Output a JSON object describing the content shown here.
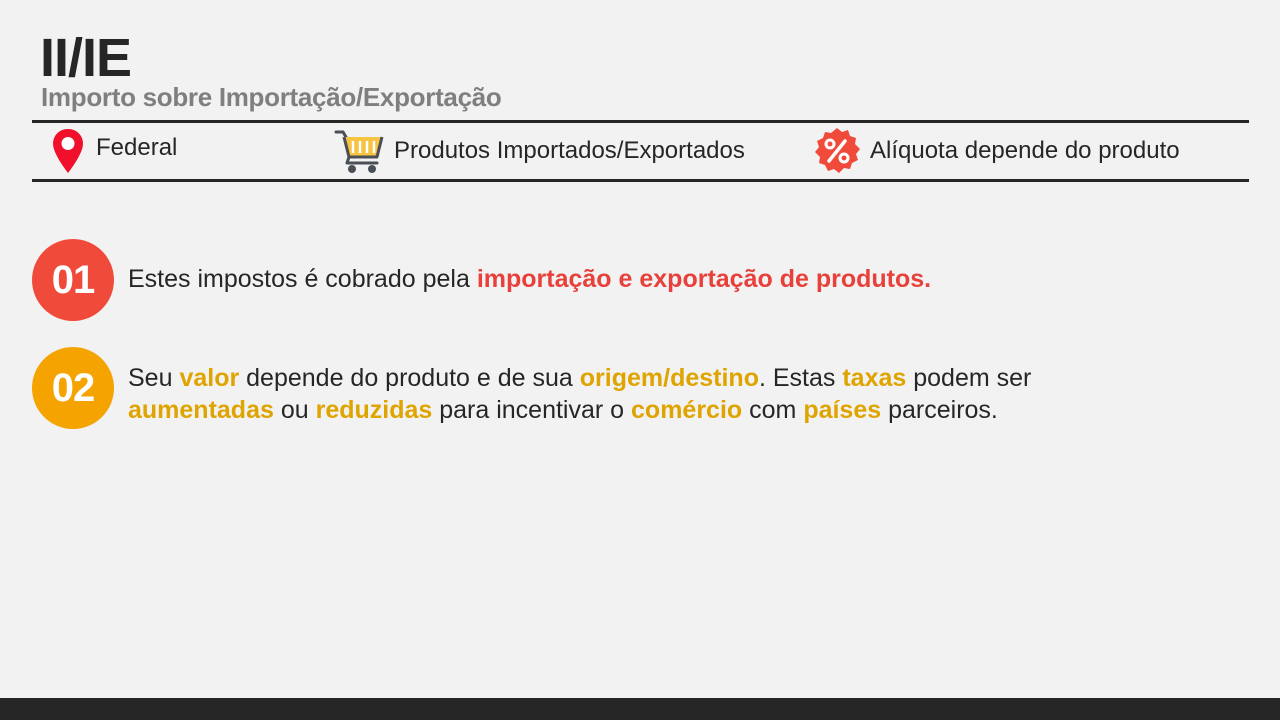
{
  "header": {
    "title": "II/IE",
    "subtitle": "Importo sobre Importação/Exportação"
  },
  "info_bar": {
    "location": {
      "icon": "map-pin-icon",
      "label": "Federal"
    },
    "products": {
      "icon": "shopping-cart-icon",
      "label": "Produtos Importados/Exportados"
    },
    "rate": {
      "icon": "percent-badge-icon",
      "label": "Alíquota depende do produto"
    }
  },
  "points": [
    {
      "number": "01",
      "color": "#f04a3b",
      "t0": "Estes impostos é cobrado pela ",
      "h0": "importação e exportação de produtos."
    },
    {
      "number": "02",
      "color": "#f5a300",
      "t0": "Seu ",
      "h0": "valor",
      "t1": " depende do produto e de sua ",
      "h1": "origem/destino",
      "t2": ". Estas ",
      "h2": "taxas",
      "t3": " podem ser ",
      "h3": "aumentadas",
      "t4": " ou ",
      "h4": "reduzidas",
      "t5": " para incentivar o ",
      "h5": "comércio",
      "t6": " com ",
      "h6": "países",
      "t7": " parceiros."
    }
  ],
  "colors": {
    "accent_red": "#e8403a",
    "accent_yellow": "#e0a400",
    "text_dark": "#262626",
    "subtitle_gray": "#7f7f7f",
    "background": "#f2f2f2"
  }
}
